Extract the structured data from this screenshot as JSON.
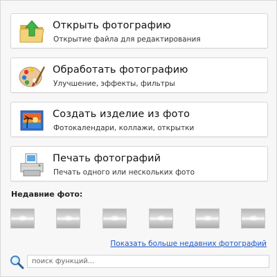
{
  "actions": [
    {
      "title": "Открыть фотографию",
      "subtitle": "Открытие файла для редактирования",
      "icon": "folder-open-icon"
    },
    {
      "title": "Обработать фотографию",
      "subtitle": "Улучшение, эффекты, фильтры",
      "icon": "palette-icon"
    },
    {
      "title": "Создать изделие из фото",
      "subtitle": "Фотокалендари, коллажи, открытки",
      "icon": "photo-landscape-icon"
    },
    {
      "title": "Печать фотографий",
      "subtitle": "Печать одного или нескольких фото",
      "icon": "printer-icon"
    }
  ],
  "recent": {
    "label": "Недавние фото:",
    "thumbnail_count": 6,
    "more_link": "Показать больше недавних фотографий"
  },
  "search": {
    "placeholder": "поиск функций..."
  },
  "colors": {
    "link": "#1a55c8",
    "card_background": "#ffffff",
    "window_background": "#f7f7f7"
  }
}
